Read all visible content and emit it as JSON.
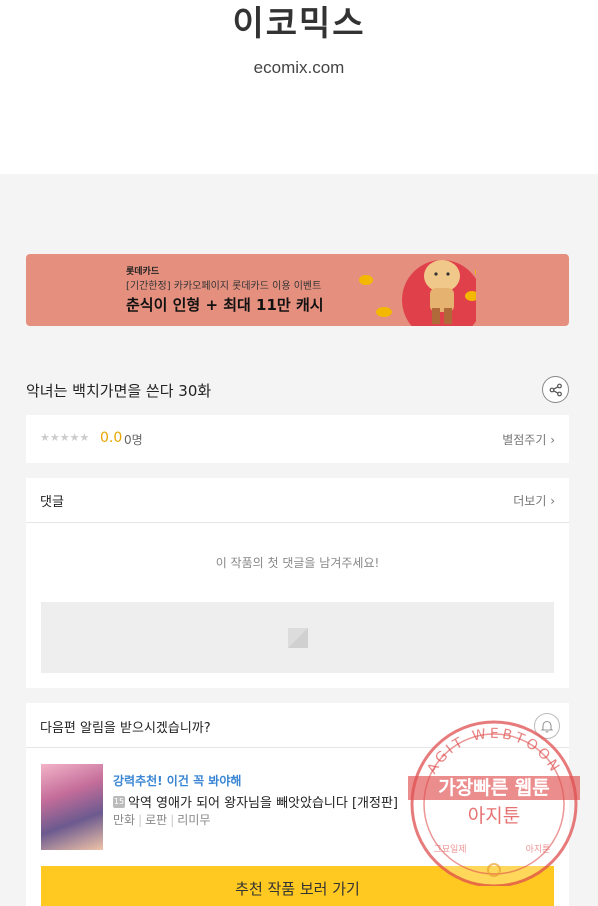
{
  "header": {
    "logo_kr": "이코믹스",
    "logo_en": "ecomix.com"
  },
  "banner": {
    "brand": "롯데카드",
    "subtitle": "[기간한정] 카카오페이지 롯데카드 이용 이벤트",
    "headline": "춘식이 인형 + 최대 11만 캐시",
    "bg_color": "#e5907f"
  },
  "episode": {
    "title": "악녀는 백치가면을 쓴다 30화",
    "share_icon": "share-icon"
  },
  "rating": {
    "stars": "★★★★★",
    "score": "0.0",
    "count": "0명",
    "rate_link": "별점주기 ›"
  },
  "comments": {
    "title": "댓글",
    "more_link": "더보기 ›",
    "empty_message": "이 작품의 첫 댓글을 남겨주세요!"
  },
  "notify": {
    "title": "다음편 알림을 받으시겠습니까?",
    "bell_icon": "bell-icon"
  },
  "recommendation": {
    "label": "강력추천! 이건 꼭 봐야해",
    "age_badge": "15",
    "title": "악역 영애가 되어 왕자님을 빼앗았습니다 [개정판]",
    "tags": [
      "만화",
      "로판",
      "리미무"
    ],
    "button_label": "추천 작품 보러 가기",
    "button_color": "#ffc921"
  },
  "watermark": {
    "top_arc": "AGIT WEBTOON",
    "line1": "가장빠른 웹툰",
    "line2": "아지툰",
    "left_small": "그묘일제",
    "right_small": "아지툰",
    "color": "#e05050"
  }
}
